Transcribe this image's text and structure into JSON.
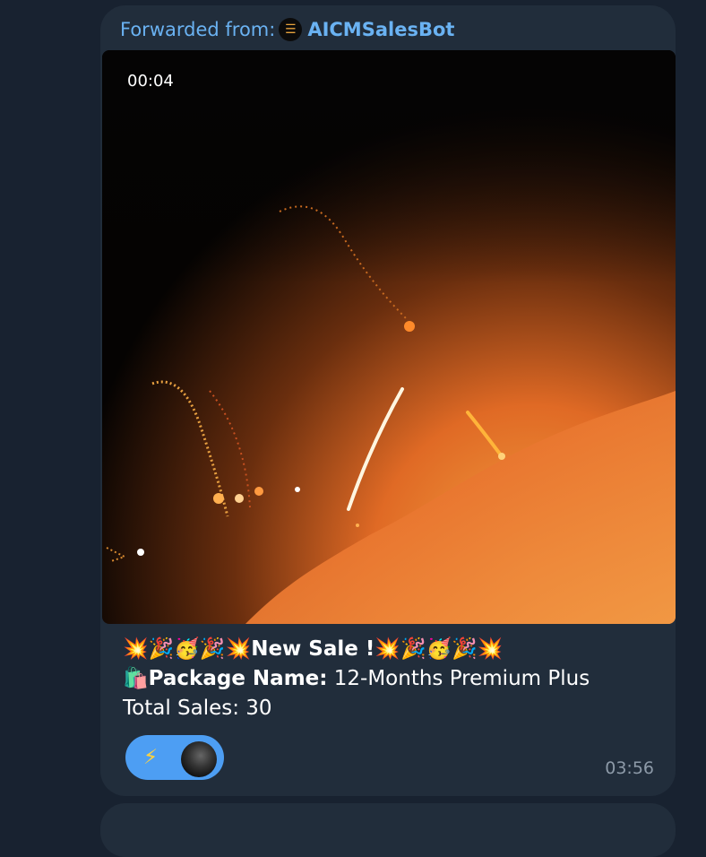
{
  "message": {
    "forward_prefix": "Forwarded from:",
    "forward_source": "AICMSalesBot",
    "video_duration": "00:04",
    "text_line1_emojis_left": "💥🎉🥳🎉💥",
    "text_line1_title": "New Sale !",
    "text_line1_emojis_right": "💥🎉🥳🎉💥",
    "package_emoji": "🛍️",
    "package_label": "Package Name:",
    "package_value": " 12-Months Premium Plus",
    "total_sales": "Total Sales: 30",
    "reaction_emoji": "⚡",
    "time": "03:56"
  },
  "colors": {
    "background": "#182230",
    "bubble": "#212d3b",
    "link": "#6ab2f2",
    "reaction": "#4d9ef3",
    "meta": "#8d9aa8"
  }
}
